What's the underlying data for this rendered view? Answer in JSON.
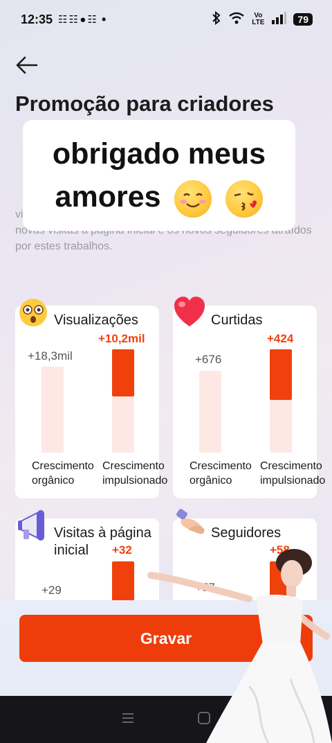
{
  "status_bar": {
    "time": "12:35",
    "notification_icons": "☷ ☷ ● ☷",
    "dot": "•",
    "volte": "Vo\nLTE",
    "battery": "79"
  },
  "header": {
    "title": "Promoção para criadores"
  },
  "description": {
    "para1_visible": "A                                                                             p                                                                                             es e                                                                                       os e",
    "para2_visible": "E                                                                                    p                                                                                             s",
    "para2_tail": "visualizações e curtidas destes trabalhos, bem como as novas visitas à página inicial e os novos seguidores atraídos por estes trabalhos."
  },
  "sticker": {
    "line1": "obrigado meus",
    "line2": "amores"
  },
  "cards": [
    {
      "title": "Visualizações",
      "icon": "astonished-face-icon",
      "organic_value": "+18,3mil",
      "boost_value": "+10,2mil",
      "organic_label": "Crescimento orgânico",
      "boost_label": "Crescimento impulsionado",
      "boost_fraction": 0.46
    },
    {
      "title": "Curtidas",
      "icon": "heart-icon",
      "organic_value": "+676",
      "boost_value": "+424",
      "organic_label": "Crescimento orgânico",
      "boost_label": "Crescimento impulsionado",
      "boost_fraction": 0.49
    },
    {
      "title": "Visitas à página inicial",
      "icon": "megaphone-icon",
      "organic_value": "+29",
      "boost_value": "+32"
    },
    {
      "title": "Seguidores",
      "icon": "handshake-icon",
      "organic_value": "+57",
      "boost_value": "+58"
    }
  ],
  "actions": {
    "record_label": "Gravar"
  },
  "nav": {
    "menu_icon": "☰",
    "home_icon": "▢"
  },
  "colors": {
    "accent": "#ee3d0b",
    "bar_track": "#fde8e3"
  }
}
